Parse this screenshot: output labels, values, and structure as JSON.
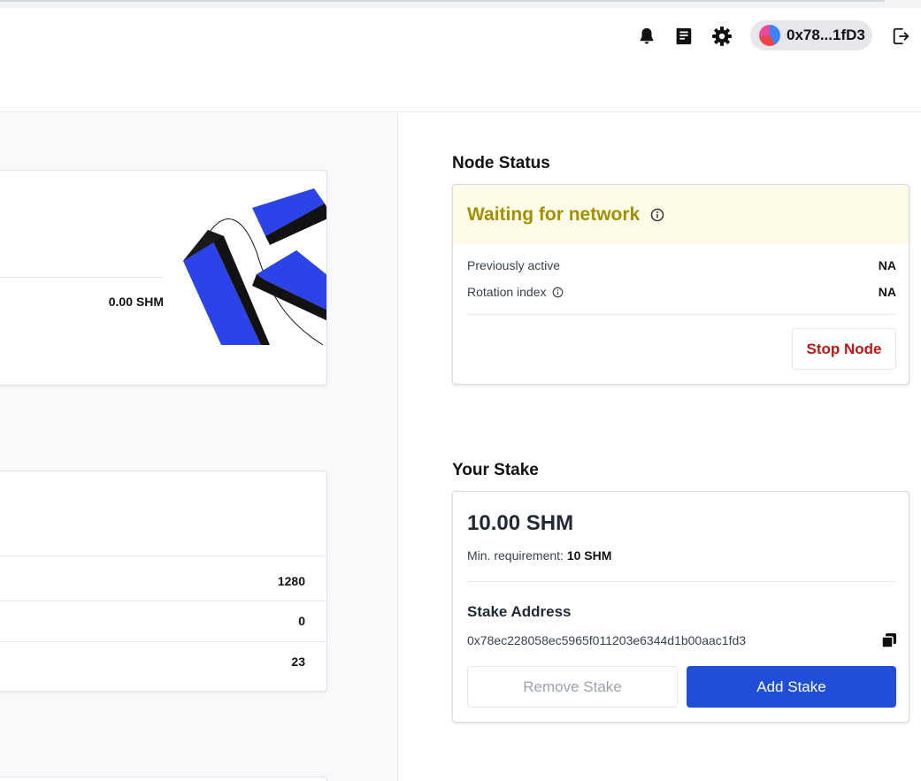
{
  "header": {
    "wallet_address": "0x78...1fD3",
    "icons": [
      "bell-icon",
      "book-icon",
      "gear-icon",
      "logout-icon"
    ]
  },
  "left": {
    "balance_value": "0.00 SHM",
    "stats": [
      "1280",
      "0",
      "23"
    ]
  },
  "node_status": {
    "title": "Node Status",
    "status": "Waiting for network",
    "previously_active_label": "Previously active",
    "previously_active_value": "NA",
    "rotation_index_label": "Rotation index",
    "rotation_index_value": "NA",
    "stop_label": "Stop Node"
  },
  "stake": {
    "title": "Your Stake",
    "amount": "10.00 SHM",
    "min_label": "Min. requirement:",
    "min_value": "10 SHM",
    "address_label": "Stake Address",
    "address": "0x78ec228058ec5965f011203e6344d1b00aac1fd3",
    "remove_label": "Remove Stake",
    "add_label": "Add Stake"
  },
  "colors": {
    "accent": "#1f4fd6",
    "warning_text": "#a19000",
    "warning_bg": "#fefce8",
    "danger": "#c01515"
  }
}
